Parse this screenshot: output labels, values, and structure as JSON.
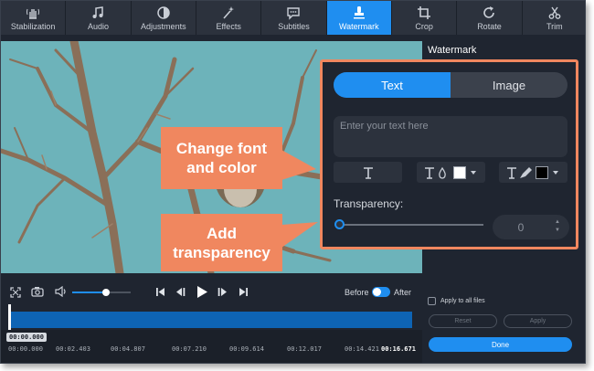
{
  "toolbar": {
    "tools": [
      {
        "label": "Stabilization",
        "icon": "hand-stabilization-icon"
      },
      {
        "label": "Audio",
        "icon": "music-note-icon"
      },
      {
        "label": "Adjustments",
        "icon": "contrast-icon"
      },
      {
        "label": "Effects",
        "icon": "magic-wand-icon"
      },
      {
        "label": "Subtitles",
        "icon": "speech-bubble-icon"
      },
      {
        "label": "Watermark",
        "icon": "stamp-icon",
        "active": true
      },
      {
        "label": "Crop",
        "icon": "crop-icon"
      },
      {
        "label": "Rotate",
        "icon": "rotate-icon"
      },
      {
        "label": "Trim",
        "icon": "scissors-icon"
      }
    ]
  },
  "panel": {
    "title": "Watermark",
    "apply_all_label": "Apply to all files",
    "reset_label": "Reset",
    "apply_label": "Apply",
    "done_label": "Done"
  },
  "watermark": {
    "tabs": [
      {
        "label": "Text",
        "active": true
      },
      {
        "label": "Image",
        "active": false
      }
    ],
    "text_placeholder": "Enter your text here",
    "font_icon": "font-icon",
    "text_color_icon": "text-color-icon",
    "text_color": "#ffffff",
    "bg_color_icon": "background-color-icon",
    "bg_color": "#000000",
    "transparency_label": "Transparency:",
    "transparency_value": "0",
    "transparency_level": 0
  },
  "callouts": {
    "font_color": "Change font and color",
    "transparency": "Add transparency"
  },
  "player": {
    "before_label": "Before",
    "after_label": "After",
    "volume_level": 0.58,
    "current_time": "00:00.000",
    "ticks": [
      "00:00.000",
      "00:02.403",
      "00:04.807",
      "00:07.210",
      "00:09.614",
      "00:12.017",
      "00:14.421",
      "00:16.671"
    ]
  },
  "colors": {
    "accent": "#1f8ef0",
    "callout": "#f0875f",
    "background": "#1f2530"
  }
}
